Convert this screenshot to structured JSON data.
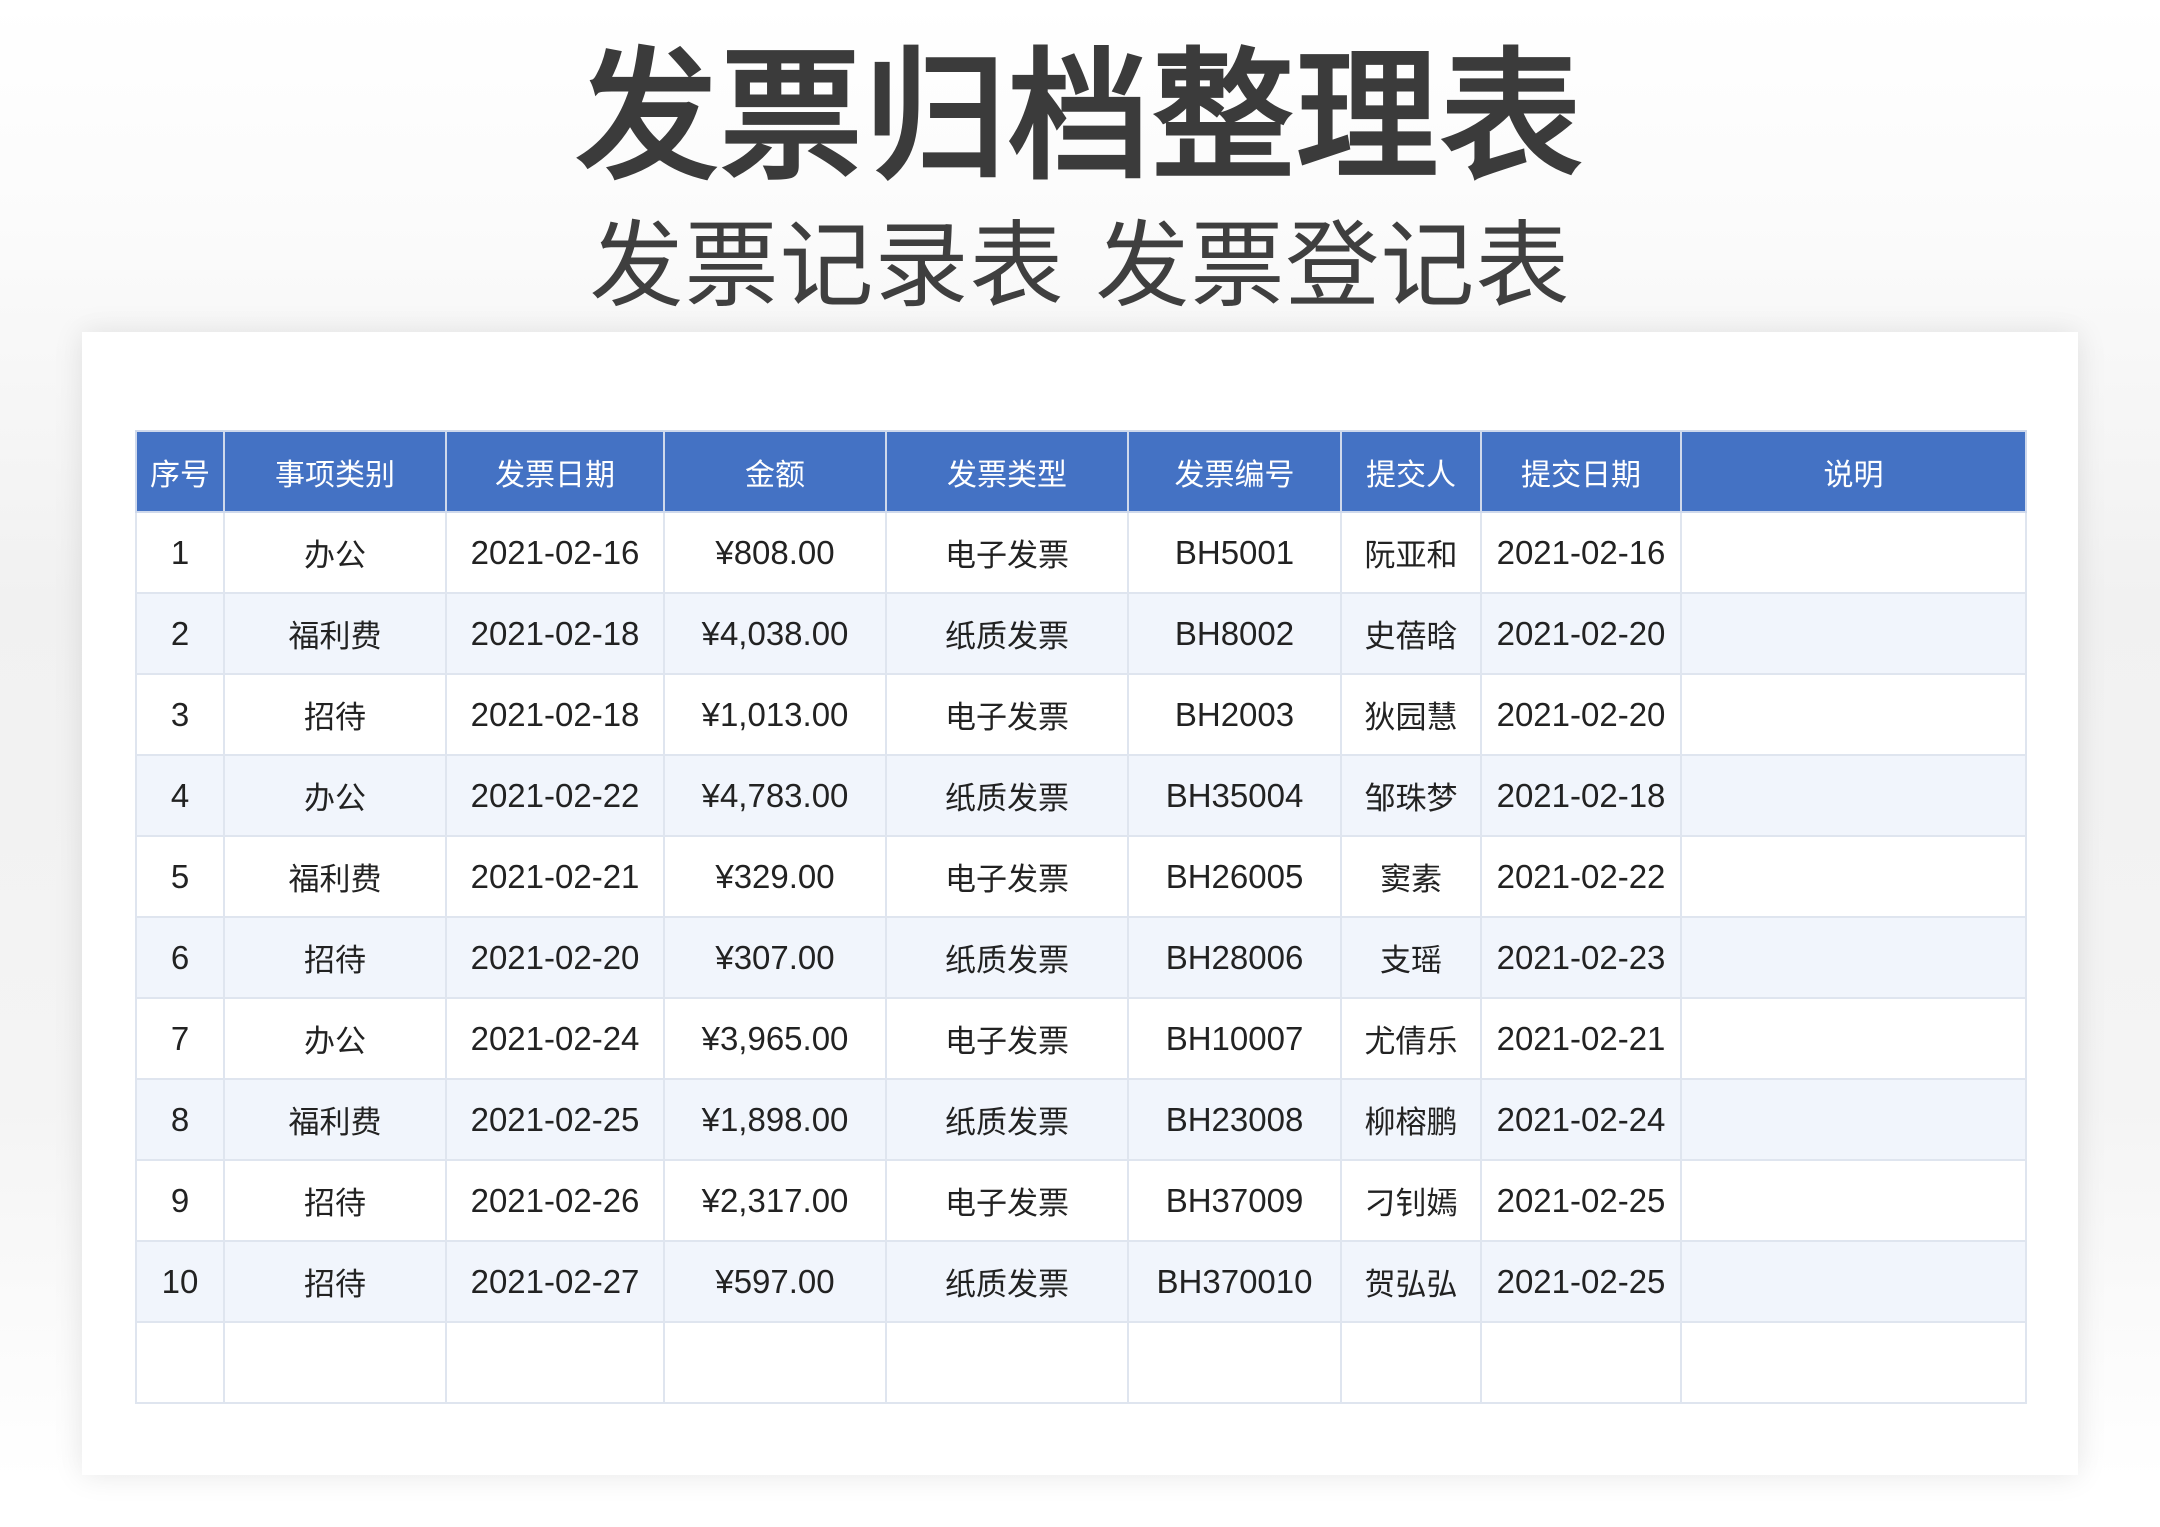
{
  "page": {
    "title": "发票归档整理表",
    "subtitle": "发票记录表 发票登记表"
  },
  "table": {
    "headers": [
      "序号",
      "事项类别",
      "发票日期",
      "金额",
      "发票类型",
      "发票编号",
      "提交人",
      "提交日期",
      "说明"
    ],
    "rows": [
      [
        "1",
        "办公",
        "2021-02-16",
        "¥808.00",
        "电子发票",
        "BH5001",
        "阮亚和",
        "2021-02-16",
        ""
      ],
      [
        "2",
        "福利费",
        "2021-02-18",
        "¥4,038.00",
        "纸质发票",
        "BH8002",
        "史蓓晗",
        "2021-02-20",
        ""
      ],
      [
        "3",
        "招待",
        "2021-02-18",
        "¥1,013.00",
        "电子发票",
        "BH2003",
        "狄园慧",
        "2021-02-20",
        ""
      ],
      [
        "4",
        "办公",
        "2021-02-22",
        "¥4,783.00",
        "纸质发票",
        "BH35004",
        "邹珠梦",
        "2021-02-18",
        ""
      ],
      [
        "5",
        "福利费",
        "2021-02-21",
        "¥329.00",
        "电子发票",
        "BH26005",
        "窦素",
        "2021-02-22",
        ""
      ],
      [
        "6",
        "招待",
        "2021-02-20",
        "¥307.00",
        "纸质发票",
        "BH28006",
        "支瑶",
        "2021-02-23",
        ""
      ],
      [
        "7",
        "办公",
        "2021-02-24",
        "¥3,965.00",
        "电子发票",
        "BH10007",
        "尤倩乐",
        "2021-02-21",
        ""
      ],
      [
        "8",
        "福利费",
        "2021-02-25",
        "¥1,898.00",
        "纸质发票",
        "BH23008",
        "柳榕鹏",
        "2021-02-24",
        ""
      ],
      [
        "9",
        "招待",
        "2021-02-26",
        "¥2,317.00",
        "电子发票",
        "BH37009",
        "刁钊嫣",
        "2021-02-25",
        ""
      ],
      [
        "10",
        "招待",
        "2021-02-27",
        "¥597.00",
        "纸质发票",
        "BH370010",
        "贺弘弘",
        "2021-02-25",
        ""
      ],
      [
        "",
        "",
        "",
        "",
        "",
        "",
        "",
        "",
        ""
      ]
    ]
  }
}
